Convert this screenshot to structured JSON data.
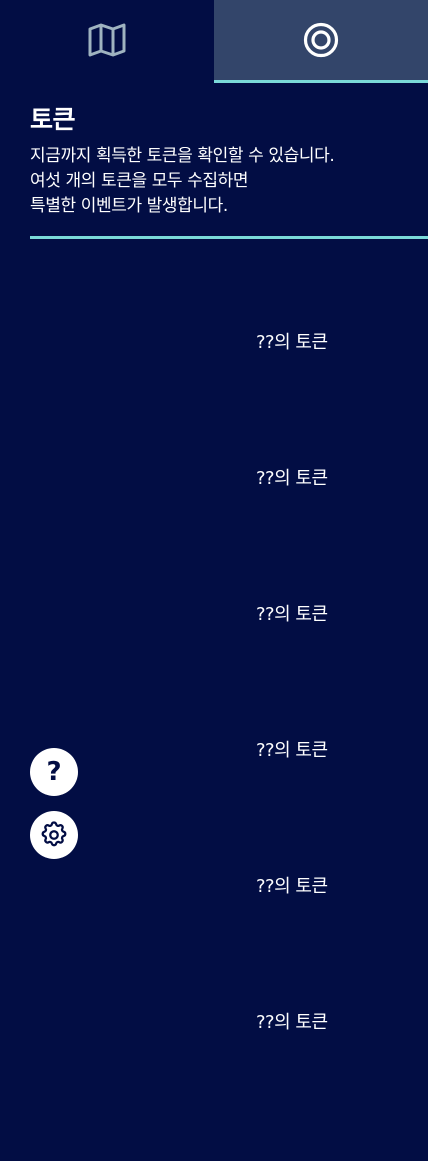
{
  "tabs": [
    {
      "name": "map",
      "icon": "map-icon",
      "selected": false
    },
    {
      "name": "tokens",
      "icon": "target-icon",
      "selected": true
    }
  ],
  "header": {
    "title": "토큰",
    "description_lines": [
      "지금까지 획득한 토큰을 확인할 수 있습니다.",
      "여섯 개의 토큰을 모두 수집하면",
      "특별한 이벤트가 발생합니다."
    ]
  },
  "tokens": [
    {
      "label": "??의 토큰"
    },
    {
      "label": "??의 토큰"
    },
    {
      "label": "??의 토큰"
    },
    {
      "label": "??의 토큰"
    },
    {
      "label": "??의 토큰"
    },
    {
      "label": "??의 토큰"
    }
  ],
  "buttons": {
    "help_icon": "help-icon",
    "help_glyph": "?",
    "settings_icon": "gear-icon"
  },
  "colors": {
    "background": "#020d44",
    "active_tab": "#33456a",
    "accent": "#7ad9d9",
    "text": "#ffffff"
  }
}
